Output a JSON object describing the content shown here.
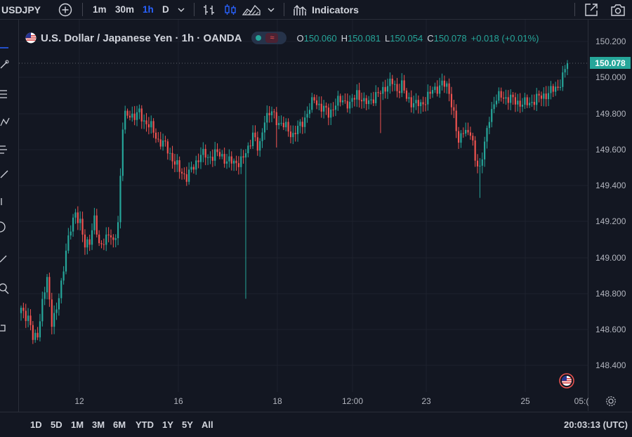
{
  "toolbar": {
    "symbol": "USDJPY",
    "timeframes": [
      "1m",
      "30m",
      "1h",
      "D"
    ],
    "active_timeframe": "1h",
    "indicators_label": "Indicators"
  },
  "legend": {
    "title": "U.S. Dollar / Japanese Yen · 1h · OANDA",
    "open_key": "O",
    "open": "150.060",
    "high_key": "H",
    "high": "150.081",
    "low_key": "L",
    "low": "150.054",
    "close_key": "C",
    "close": "150.078",
    "change": "+0.018 (+0.01%)",
    "badge_symbol": "≈"
  },
  "price_axis": {
    "labels": [
      "150.200",
      "150.000",
      "149.800",
      "149.600",
      "149.400",
      "149.200",
      "149.000",
      "148.800",
      "148.600",
      "148.400"
    ],
    "last_price": "150.078"
  },
  "time_axis": {
    "labels": [
      "12",
      "16",
      "18",
      "12:00",
      "23",
      "25",
      "05:("
    ]
  },
  "bottom_bar": {
    "ranges": [
      "1D",
      "5D",
      "1M",
      "3M",
      "6M",
      "YTD",
      "1Y",
      "5Y",
      "All"
    ],
    "clock": "20:03:13 (UTC)"
  },
  "colors": {
    "background": "#131722",
    "up": "#26a69a",
    "down": "#ef5350",
    "grid": "#1e222d",
    "active": "#2962ff"
  },
  "chart_data": {
    "type": "candlestick",
    "title": "U.S. Dollar / Japanese Yen · 1h · OANDA",
    "ylim": [
      148.3,
      150.25
    ],
    "x_labels": [
      "12",
      "16",
      "18",
      "12:00",
      "23",
      "25",
      "05:("
    ],
    "waypoints": [
      [
        0,
        148.72
      ],
      [
        3,
        148.66
      ],
      [
        5,
        148.55
      ],
      [
        7,
        148.58
      ],
      [
        9,
        148.74
      ],
      [
        11,
        148.88
      ],
      [
        13,
        148.65
      ],
      [
        15,
        148.7
      ],
      [
        17,
        148.85
      ],
      [
        19,
        149.05
      ],
      [
        21,
        149.15
      ],
      [
        23,
        149.25
      ],
      [
        25,
        149.2
      ],
      [
        27,
        149.05
      ],
      [
        29,
        149.1
      ],
      [
        31,
        149.22
      ],
      [
        33,
        149.05
      ],
      [
        35,
        149.1
      ],
      [
        37,
        149.13
      ],
      [
        39,
        149.07
      ],
      [
        41,
        149.2
      ],
      [
        42,
        149.45
      ],
      [
        43,
        149.72
      ],
      [
        44,
        149.78
      ],
      [
        46,
        149.8
      ],
      [
        48,
        149.78
      ],
      [
        50,
        149.8
      ],
      [
        52,
        149.76
      ],
      [
        55,
        149.72
      ],
      [
        58,
        149.65
      ],
      [
        61,
        149.62
      ],
      [
        64,
        149.55
      ],
      [
        67,
        149.48
      ],
      [
        70,
        149.45
      ],
      [
        73,
        149.5
      ],
      [
        76,
        149.58
      ],
      [
        79,
        149.55
      ],
      [
        82,
        149.58
      ],
      [
        86,
        149.55
      ],
      [
        90,
        149.52
      ],
      [
        94,
        149.55
      ],
      [
        96,
        149.6
      ],
      [
        98,
        149.7
      ],
      [
        100,
        149.6
      ],
      [
        101,
        149.62
      ],
      [
        103,
        149.78
      ],
      [
        106,
        149.8
      ],
      [
        109,
        149.75
      ],
      [
        112,
        149.72
      ],
      [
        115,
        149.68
      ],
      [
        118,
        149.73
      ],
      [
        121,
        149.8
      ],
      [
        124,
        149.88
      ],
      [
        127,
        149.83
      ],
      [
        130,
        149.8
      ],
      [
        133,
        149.85
      ],
      [
        136,
        149.88
      ],
      [
        139,
        149.84
      ],
      [
        142,
        149.92
      ],
      [
        145,
        149.85
      ],
      [
        148,
        149.88
      ],
      [
        151,
        149.9
      ],
      [
        154,
        149.95
      ],
      [
        157,
        149.97
      ],
      [
        159,
        149.93
      ],
      [
        161,
        149.96
      ],
      [
        163,
        149.88
      ],
      [
        166,
        149.86
      ],
      [
        169,
        149.84
      ],
      [
        172,
        149.9
      ],
      [
        175,
        149.93
      ],
      [
        178,
        149.97
      ],
      [
        181,
        149.92
      ],
      [
        183,
        149.8
      ],
      [
        185,
        149.62
      ],
      [
        187,
        149.72
      ],
      [
        190,
        149.68
      ],
      [
        192,
        149.55
      ],
      [
        194,
        149.5
      ],
      [
        196,
        149.62
      ],
      [
        198,
        149.78
      ],
      [
        200,
        149.86
      ],
      [
        203,
        149.9
      ],
      [
        206,
        149.88
      ],
      [
        209,
        149.87
      ],
      [
        212,
        149.85
      ],
      [
        215,
        149.86
      ],
      [
        218,
        149.88
      ],
      [
        221,
        149.9
      ],
      [
        224,
        149.92
      ],
      [
        227,
        149.95
      ],
      [
        229,
        150.0
      ],
      [
        231,
        150.078
      ]
    ],
    "wick_spikes": [
      {
        "index": 95,
        "low": 148.77
      },
      {
        "index": 108,
        "low": 149.61
      },
      {
        "index": 152,
        "low": 149.69
      },
      {
        "index": 194,
        "low": 149.33
      }
    ]
  }
}
